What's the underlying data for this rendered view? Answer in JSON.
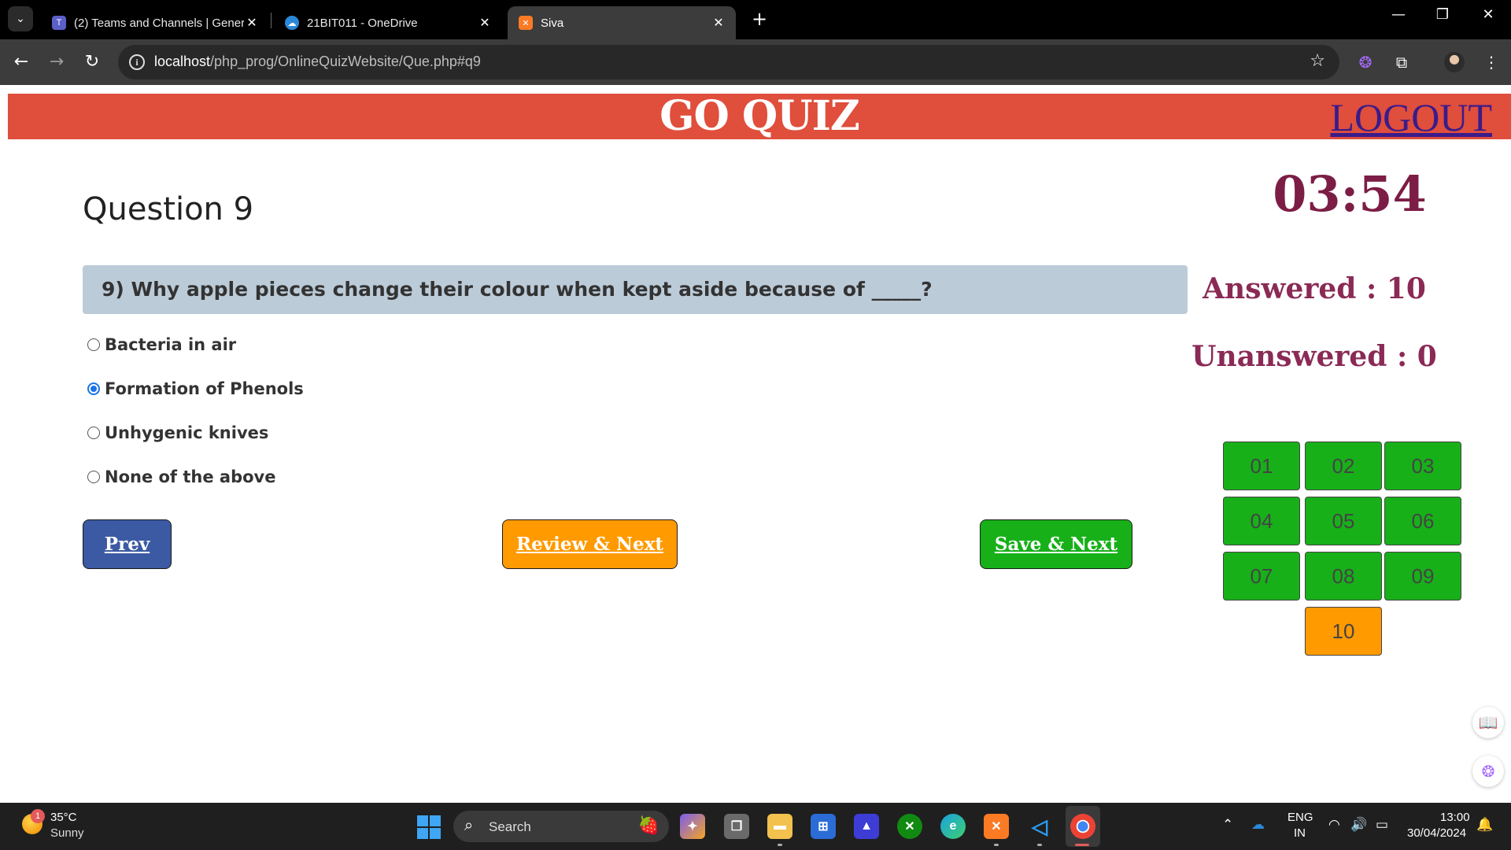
{
  "browser": {
    "tabs": [
      {
        "title": "(2) Teams and Channels | General",
        "icon": "teams-icon",
        "color": "#5b5fc7"
      },
      {
        "title": "21BIT011 - OneDrive",
        "icon": "onedrive-icon",
        "color": "#2b88d8"
      },
      {
        "title": "Siva",
        "icon": "xampp-icon",
        "color": "#fb7a24",
        "active": true
      }
    ],
    "url_host": "localhost",
    "url_path": "/php_prog/OnlineQuizWebsite/Que.php#q9"
  },
  "header": {
    "title": "GO QUIZ",
    "logout_label": "LOGOUT",
    "bg_color": "#e04e3c"
  },
  "question": {
    "heading": "Question 9",
    "text": "9) Why apple pieces change their colour when kept aside because of _____?",
    "options": [
      {
        "label": "Bacteria in air",
        "selected": false
      },
      {
        "label": "Formation of Phenols",
        "selected": true
      },
      {
        "label": "Unhygenic knives",
        "selected": false
      },
      {
        "label": "None of the above",
        "selected": false
      }
    ]
  },
  "buttons": {
    "prev": "Prev",
    "review_next": "Review & Next",
    "save_next": "Save & Next"
  },
  "sidebar": {
    "timer": "03:54",
    "answered": "Answered : 10",
    "unanswered": "Unanswered : 0",
    "question_numbers": [
      {
        "label": "01",
        "status": "answered"
      },
      {
        "label": "02",
        "status": "answered"
      },
      {
        "label": "03",
        "status": "answered"
      },
      {
        "label": "04",
        "status": "answered"
      },
      {
        "label": "05",
        "status": "answered"
      },
      {
        "label": "06",
        "status": "answered"
      },
      {
        "label": "07",
        "status": "answered"
      },
      {
        "label": "08",
        "status": "answered"
      },
      {
        "label": "09",
        "status": "answered"
      },
      {
        "label": "10",
        "status": "review"
      }
    ],
    "colors": {
      "answered": "#17b019",
      "review": "#ff9a00"
    }
  },
  "taskbar": {
    "weather_temp": "35°C",
    "weather_desc": "Sunny",
    "weather_badge": "1",
    "search_label": "Search",
    "lang_line1": "ENG",
    "lang_line2": "IN",
    "time": "13:00",
    "date": "30/04/2024"
  }
}
